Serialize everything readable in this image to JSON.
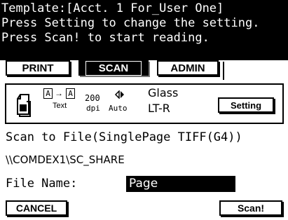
{
  "header": {
    "line1": "Template:[Acct. 1 For_User One]",
    "line2": "Press Setting to change the setting.",
    "line3": "Press Scan! to start reading."
  },
  "tabs": [
    {
      "label": "PRINT",
      "selected": false
    },
    {
      "label": "SCAN",
      "selected": true
    },
    {
      "label": "ADMIN",
      "selected": false
    }
  ],
  "settings": {
    "mode_from": "A",
    "mode_to": "A",
    "mode_label": "Text",
    "resolution": "200",
    "resolution_unit": "dpi",
    "density_label": "Auto",
    "original_line1": "Glass",
    "original_line2": "LT-R",
    "setting_button": "Setting"
  },
  "destination": {
    "format_line": "Scan to File(SinglePage TIFF(G4))",
    "path": "\\\\COMDEX1\\SC_SHARE",
    "file_name_label": "File Name:",
    "file_name_value": "Page"
  },
  "footer": {
    "cancel_label": "CANCEL",
    "scan_label": "Scan!"
  }
}
